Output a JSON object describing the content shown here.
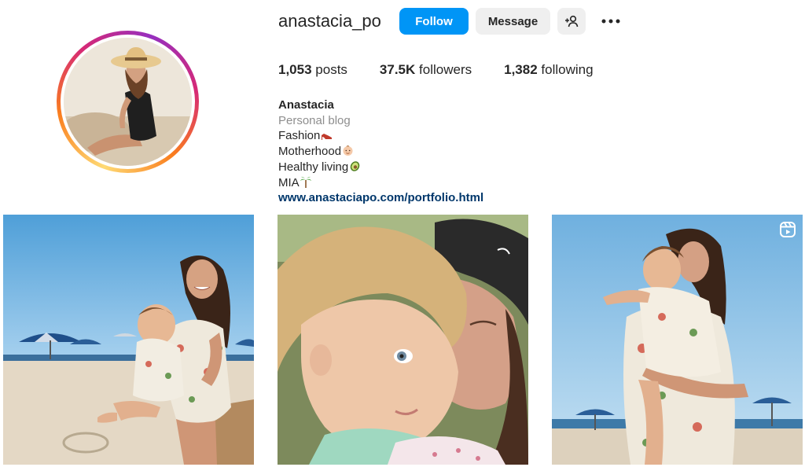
{
  "profile": {
    "username": "anastacia_po",
    "follow_label": "Follow",
    "message_label": "Message",
    "add_user_icon": "add-user-icon",
    "more_icon": "more-options-icon"
  },
  "stats": {
    "posts_count": "1,053",
    "posts_label": "posts",
    "followers_count": "37.5K",
    "followers_label": "followers",
    "following_count": "1,382",
    "following_label": "following"
  },
  "bio": {
    "name": "Anastacia",
    "category": "Personal blog",
    "lines": [
      "Fashion",
      "Motherhood",
      "Healthy living",
      "MIA"
    ],
    "line_icons": [
      "high-heel-emoji",
      "baby-emoji",
      "avocado-emoji",
      "palm-tree-emoji"
    ],
    "link": "www.anastaciapo.com/portfolio.html"
  },
  "posts": [
    {
      "kind": "photo"
    },
    {
      "kind": "photo"
    },
    {
      "kind": "reel",
      "icon": "reels-icon"
    }
  ],
  "colors": {
    "follow_button": "#0095f6",
    "secondary_button": "#efefef",
    "link": "#00376b",
    "muted_text": "#8e8e8e",
    "story_ring": [
      "#feda75",
      "#fa7e1e",
      "#d62976",
      "#962fbf"
    ]
  }
}
